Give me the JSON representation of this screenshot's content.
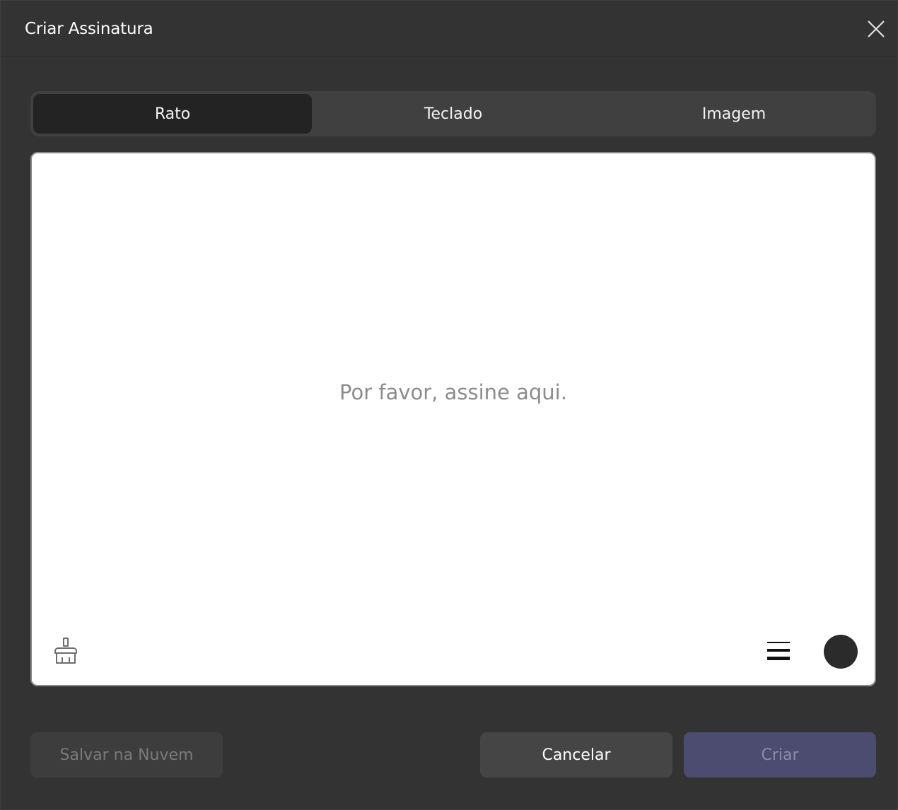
{
  "dialog": {
    "title": "Criar Assinatura"
  },
  "tabs": [
    {
      "label": "Rato",
      "active": true
    },
    {
      "label": "Teclado",
      "active": false
    },
    {
      "label": "Imagem",
      "active": false
    }
  ],
  "canvas": {
    "placeholder": "Por favor, assine aqui.",
    "pen_color": "#2b2b2b",
    "eraser_icon": "eraser-brush-icon",
    "thickness_icon": "line-thickness-icon"
  },
  "footer": {
    "save_cloud_label": "Salvar na Nuvem",
    "cancel_label": "Cancelar",
    "create_label": "Criar"
  },
  "colors": {
    "accent": "#4c4b70",
    "background": "#333333"
  }
}
